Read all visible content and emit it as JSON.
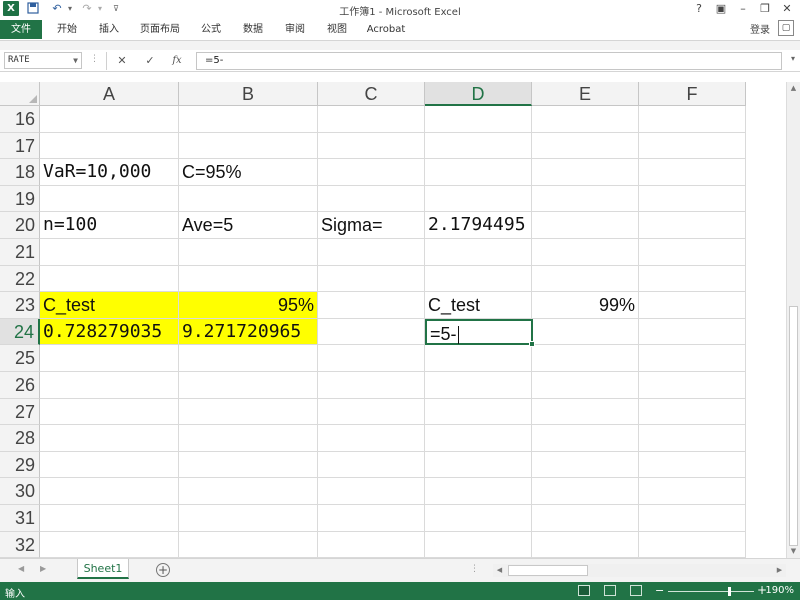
{
  "window": {
    "title": "工作簿1 - Microsoft Excel",
    "controls": [
      "?",
      "▣",
      "–",
      "❐",
      "✕"
    ]
  },
  "quick_access": {
    "logo_text": "X",
    "icons": [
      "save-icon",
      "undo-icon",
      "redo-icon",
      "customize-icon"
    ]
  },
  "ribbon": {
    "tabs": [
      "文件",
      "开始",
      "插入",
      "页面布局",
      "公式",
      "数据",
      "审阅",
      "视图",
      "Acrobat"
    ],
    "login_label": "登录"
  },
  "formula_bar": {
    "name_box": "RATE",
    "cancel_symbol": "✕",
    "enter_symbol": "✓",
    "function_symbol": "fx",
    "content": "=5-"
  },
  "grid": {
    "columns": [
      "A",
      "B",
      "C",
      "D",
      "E",
      "F"
    ],
    "selected_column": "D",
    "rows": [
      {
        "num": "16",
        "cells": {}
      },
      {
        "num": "17",
        "cells": {}
      },
      {
        "num": "18",
        "cells": {
          "A": "VaR=10,000",
          "B": "C=95%"
        }
      },
      {
        "num": "19",
        "cells": {}
      },
      {
        "num": "20",
        "cells": {
          "A": "n=100",
          "B": "Ave=5",
          "C": "Sigma=",
          "D": "2.1794495"
        }
      },
      {
        "num": "21",
        "cells": {}
      },
      {
        "num": "22",
        "cells": {}
      },
      {
        "num": "23",
        "cells": {
          "A": "C_test",
          "B": "95%",
          "D": "C_test",
          "E": "99%"
        }
      },
      {
        "num": "24",
        "cells": {
          "A": "0.728279035",
          "B": "9.271720965",
          "D": "=5-"
        }
      },
      {
        "num": "25",
        "cells": {}
      },
      {
        "num": "26",
        "cells": {}
      },
      {
        "num": "27",
        "cells": {}
      },
      {
        "num": "28",
        "cells": {}
      },
      {
        "num": "29",
        "cells": {}
      },
      {
        "num": "30",
        "cells": {}
      },
      {
        "num": "31",
        "cells": {}
      },
      {
        "num": "32",
        "cells": {}
      }
    ],
    "active_cell": "D24",
    "highlight_color": "#FFFF00"
  },
  "sheets": {
    "tabs": [
      "Sheet1"
    ],
    "active": "Sheet1",
    "add_symbol": "+"
  },
  "status_bar": {
    "mode": "输入",
    "zoom_level": "190%",
    "zoom_minus": "−",
    "zoom_plus": "+",
    "accent_color": "#217346"
  }
}
